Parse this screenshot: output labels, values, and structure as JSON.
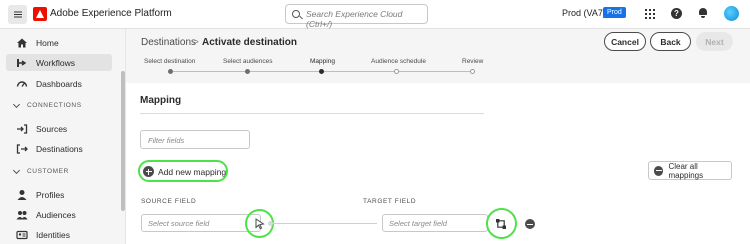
{
  "header": {
    "app_title": "Adobe Experience Platform",
    "search_placeholder": "Search Experience Cloud (Ctrl+/)",
    "org": "Prod (VA7)",
    "sandbox_badge": "Prod"
  },
  "sidebar": {
    "items": [
      {
        "label": "Home",
        "icon": "home-icon"
      },
      {
        "label": "Workflows",
        "icon": "workflows-icon",
        "active": true
      },
      {
        "label": "Dashboards",
        "icon": "dashboards-icon"
      }
    ],
    "section_connections": "CONNECTIONS",
    "connections_items": [
      {
        "label": "Sources",
        "icon": "sources-icon"
      },
      {
        "label": "Destinations",
        "icon": "destinations-icon"
      }
    ],
    "section_customer": "CUSTOMER",
    "customer_items": [
      {
        "label": "Profiles",
        "icon": "profile-icon"
      },
      {
        "label": "Audiences",
        "icon": "audiences-icon"
      },
      {
        "label": "Identities",
        "icon": "identities-icon"
      }
    ]
  },
  "main": {
    "breadcrumb": "Destinations",
    "breadcrumb_sep": ">",
    "page_title": "Activate destination",
    "buttons": {
      "cancel": "Cancel",
      "back": "Back",
      "next": "Next"
    },
    "steps": [
      "Select destination",
      "Select audiences",
      "Mapping",
      "Audience schedule",
      "Review"
    ],
    "current_step": 2,
    "section_title": "Mapping",
    "filter_placeholder": "Filter fields",
    "add_mapping_label": "Add new mapping",
    "clear_all_label": "Clear all mappings",
    "source_label": "SOURCE FIELD",
    "target_label": "TARGET FIELD",
    "source_placeholder": "Select source field",
    "target_placeholder": "Select target field"
  },
  "colors": {
    "accent": "#1473e6",
    "highlight": "#4ee24a",
    "brand": "#eb1000"
  }
}
